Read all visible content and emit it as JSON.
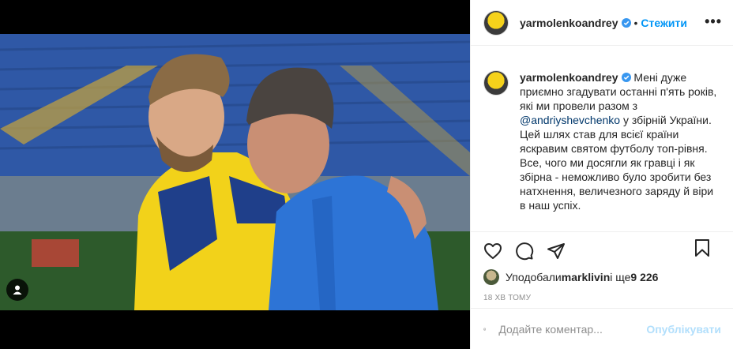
{
  "post": {
    "username": "yarmolenkoandrey",
    "follow_label": "Стежити",
    "separator": "•",
    "more_label": "•••",
    "caption_part1": " Мені дуже приємно згадувати останні п'ять років, які ми провели разом з ",
    "mention": "@andriyshevchenko",
    "caption_part2": " у збірній України.  Цей шлях став для всієї країни яскравим святом футболу топ-рівня.  Все, чого ми досягли як гравці і як збірна - неможливо було зробити без натхнення, величезного заряду й віри в наш успіх.",
    "likes_prefix": "Уподобали ",
    "likes_user": "marklivin",
    "likes_middle": " і ще ",
    "likes_count": "9 226",
    "time_ago": "18 ХВ ТОМУ",
    "comment_placeholder": "Додайте коментар...",
    "publish_label": "Опублікувати"
  },
  "icons": {
    "like": "heart-icon",
    "comment": "comment-icon",
    "share": "share-icon",
    "save": "bookmark-icon",
    "emoji": "emoji-icon",
    "verified": "verified-badge-icon",
    "tag": "user-tag-icon"
  },
  "colors": {
    "accent": "#0095f6",
    "verified": "#3897f0",
    "publish_disabled": "#b2dffc",
    "muted": "#8e8e8e"
  }
}
